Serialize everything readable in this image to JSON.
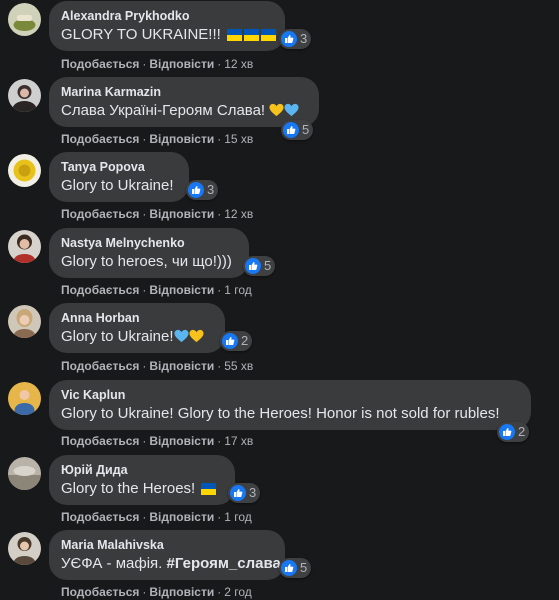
{
  "actions": {
    "like": "Подобається",
    "reply": "Відповісти",
    "separator": "·"
  },
  "comments": [
    {
      "author": "Alexandra Prykhodko",
      "text": "GLORY TO UKRAINE!!!",
      "reactions": "3",
      "time": "12 хв"
    },
    {
      "author": "Marina Karmazin",
      "text": "Слава Україні-Героям Слава!",
      "reactions": "5",
      "time": "15 хв"
    },
    {
      "author": "Tanya Popova",
      "text": "Glory to Ukraine!",
      "reactions": "3",
      "time": "12 хв"
    },
    {
      "author": "Nastya Melnychenko",
      "text": "Glory to heroes, чи що!)))",
      "reactions": "5",
      "time": "1 год"
    },
    {
      "author": "Anna Horban",
      "text": "Glory to Ukraine!",
      "reactions": "2",
      "time": "55 хв"
    },
    {
      "author": "Vic Kaplun",
      "text": "Glory to Ukraine! Glory to the Heroes! Honor is not sold for rubles!",
      "reactions": "2",
      "time": "17 хв"
    },
    {
      "author": "Юрій Дида",
      "text": "Glory to the Heroes!",
      "reactions": "3",
      "time": "1 год"
    },
    {
      "author": "Maria Malahivska",
      "text": "УЄФА - мафія.",
      "hashtag": "#Героям_слава",
      "reactions": "5",
      "time": "2 год"
    }
  ],
  "colors": {
    "background": "#18191a",
    "bubble": "#3a3b3c",
    "text": "#e4e6eb",
    "secondary": "#b0b3b8",
    "like_blue": "#1877f2",
    "flag_blue": "#0057b7",
    "flag_yellow": "#ffd700",
    "heart_yellow": "#f7c21b",
    "heart_blue": "#5ab5f0"
  },
  "icons": [
    "like-icon",
    "ukraine-flag-icon",
    "yellow-heart-icon",
    "blue-heart-icon"
  ]
}
